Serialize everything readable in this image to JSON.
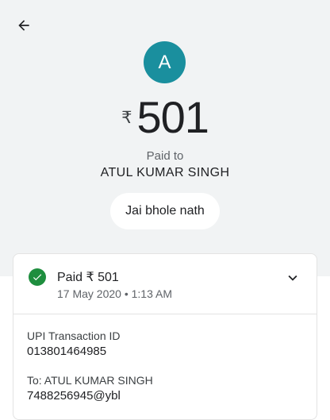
{
  "header": {
    "back_icon": "arrow-back-icon"
  },
  "payee": {
    "avatar_letter": "A",
    "avatar_color": "#1a8f9e",
    "name": "ATUL KUMAR SINGH"
  },
  "payment": {
    "currency_symbol": "₹",
    "amount": "501",
    "paid_to_label": "Paid to",
    "note": "Jai bhole nath"
  },
  "status_card": {
    "status_icon": "check-circle-icon",
    "status_color": "#1e8e3e",
    "title": "Paid ₹ 501",
    "date": "17 May 2020 • 1:13 AM",
    "expand_icon": "chevron-down-icon"
  },
  "details": {
    "transaction_id_label": "UPI Transaction ID",
    "transaction_id": "013801464985",
    "to_label": "To: ATUL KUMAR SINGH",
    "to_upi": "7488256945@ybl"
  }
}
